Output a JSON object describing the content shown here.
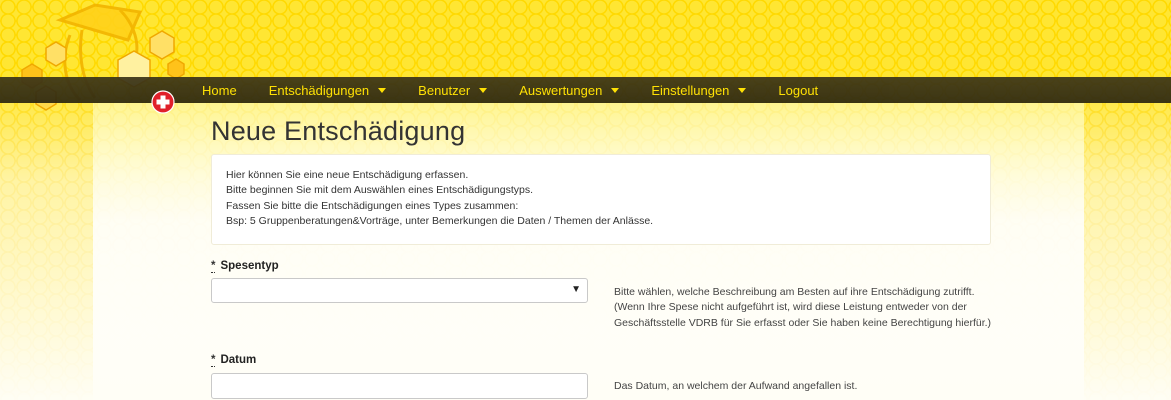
{
  "nav": {
    "items": [
      {
        "label": "Home",
        "dropdown": false
      },
      {
        "label": "Entschädigungen",
        "dropdown": true
      },
      {
        "label": "Benutzer",
        "dropdown": true
      },
      {
        "label": "Auswertungen",
        "dropdown": true
      },
      {
        "label": "Einstellungen",
        "dropdown": true
      },
      {
        "label": "Logout",
        "dropdown": false
      }
    ]
  },
  "page": {
    "title": "Neue Entschädigung",
    "info_lines": [
      "Hier können Sie eine neue Entschädigung erfassen.",
      "Bitte beginnen Sie mit dem Auswählen eines Entschädigungstyps.",
      "Fassen Sie bitte die Entschädigungen eines Types zusammen:",
      "Bsp: 5 Gruppenberatungen&Vorträge, unter Bemerkungen die Daten / Themen der Anlässe."
    ]
  },
  "form": {
    "spesentyp": {
      "required_mark": "*",
      "label": "Spesentyp",
      "value": "",
      "help_lines": [
        "Bitte wählen, welche Beschreibung am Besten auf ihre Entschädigung zutrifft.",
        "(Wenn Ihre Spese nicht aufgeführt ist, wird diese Leistung entweder von der",
        "Geschäftsstelle VDRB für Sie erfasst oder Sie haben keine Berechtigung hierfür.)"
      ]
    },
    "datum": {
      "required_mark": "*",
      "label": "Datum",
      "value": "",
      "help_lines": [
        "Das Datum, an welchem der Aufwand angefallen ist."
      ]
    }
  },
  "colors": {
    "nav_text": "#ffe100",
    "nav_bg": "#2f2912",
    "honey": "#ffe21a"
  },
  "icons": {
    "logo": "bee-honeycomb-logo",
    "swiss": "swiss-cross-icon",
    "dropdown": "caret-down-icon"
  }
}
